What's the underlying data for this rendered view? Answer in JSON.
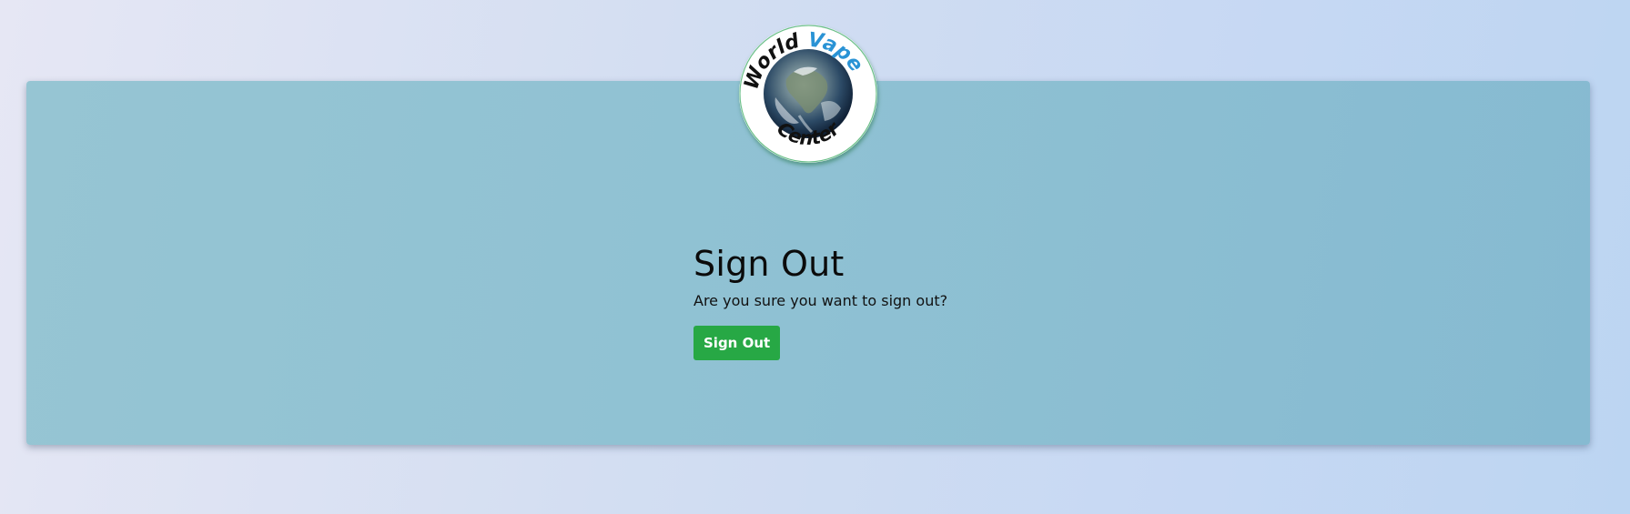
{
  "logo": {
    "word_world": "World",
    "word_vape": "Vape",
    "word_center": "Center",
    "colors": {
      "world_text": "#111111",
      "vape_text": "#2a93d5",
      "center_text": "#111111",
      "ring_border": "#6cc08a"
    }
  },
  "main": {
    "title": "Sign Out",
    "question": "Are you sure you want to sign out?",
    "signout_button_label": "Sign Out",
    "colors": {
      "card_background": "#90c1d3",
      "button_background": "#27a845",
      "button_text": "#ffffff"
    }
  }
}
